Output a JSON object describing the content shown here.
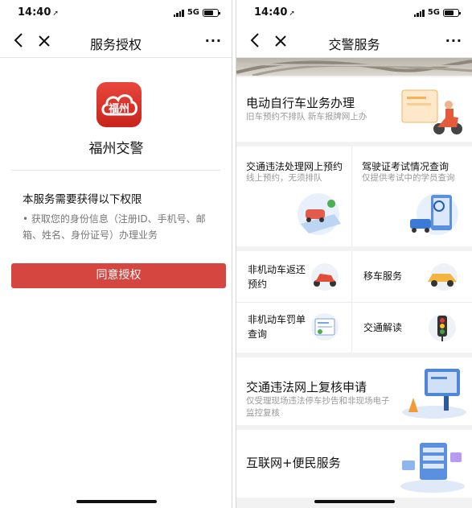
{
  "left_phone": {
    "status_time": "14:40",
    "network": "5G",
    "nav_title": "服务授权",
    "app_name": "福州交警",
    "logo_text": "福州",
    "permission_title": "本服务需要获得以下权限",
    "permission_desc": "• 获取您的身份信息（注册ID、手机号、邮箱、姓名、身份证号）办理业务",
    "agree_button": "同意授权"
  },
  "right_phone": {
    "status_time": "14:40",
    "network": "5G",
    "nav_title": "交警服务",
    "cards": {
      "ebike": {
        "title": "电动自行车业务办理",
        "subtitle": "旧车预约不排队 新车报牌网上办"
      },
      "violation_appointment": {
        "title": "交通违法处理网上预约",
        "subtitle": "线上预约，无须排队"
      },
      "license_exam": {
        "title": "驾驶证考试情况查询",
        "subtitle": "仅提供考试中的学员查询"
      },
      "nonmotor_return": {
        "title_line1": "非机动车返还",
        "title_line2": "预约"
      },
      "move_car": {
        "title": "移车服务"
      },
      "nonmotor_fine": {
        "title_line1": "非机动车罚单",
        "title_line2": "查询"
      },
      "traffic_explain": {
        "title": "交通解读"
      },
      "violation_review": {
        "title": "交通违法网上复核申请",
        "subtitle_line1": "仅受理现场违法停车抄告和非现场电子",
        "subtitle_line2": "监控复核"
      },
      "internet_service": {
        "title": "互联网+便民服务"
      }
    }
  }
}
